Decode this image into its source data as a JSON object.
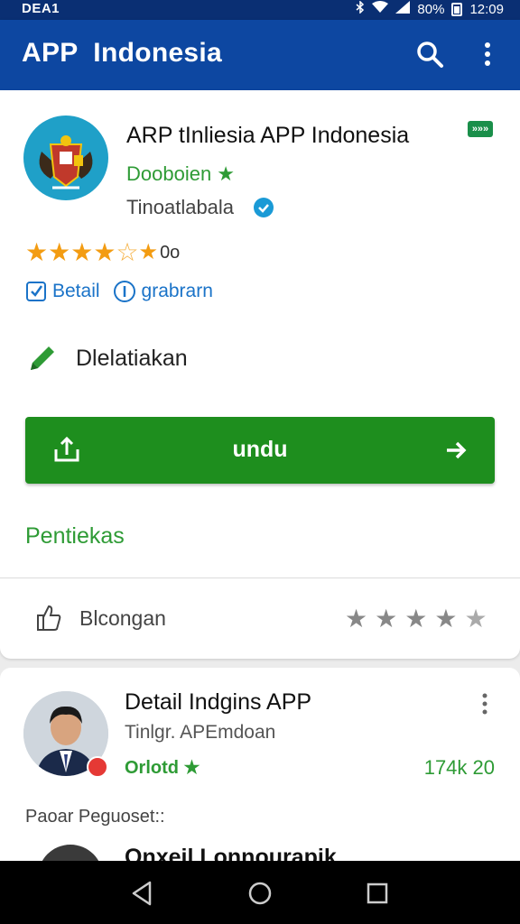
{
  "status_bar": {
    "carrier": "DEA1",
    "battery": "80%",
    "time": "12:09"
  },
  "app_bar": {
    "title": "APP  Indonesia"
  },
  "app_card": {
    "name": "ARP tInliesia APP Indonesia",
    "badge": "»»»",
    "developer": "Dooboien ★",
    "category": "Tinoatlabala",
    "rating_count": "0o",
    "rating_stars": 5,
    "links": {
      "detail": "Betail",
      "info": "grabrarn"
    },
    "edit_label": "Dlelatiakan",
    "download_label": "undu",
    "section_title": "Pentiekas",
    "review_label": "Blcongan"
  },
  "list_item": {
    "title": "Detail Indgins APP",
    "subtitle": "Tinlgr. APEmdoan",
    "developer": "Orlotd ★",
    "count": "174k 20",
    "footer": "Paoar Peguoset::",
    "next_title": "Onxeil Lonnourapik"
  },
  "colors": {
    "primary": "#0d47a1",
    "accent_green": "#1e8e1e",
    "star": "#f39c12",
    "link": "#1a73c8"
  },
  "icons": [
    "wifi-icon",
    "signal-icon",
    "battery-icon",
    "search-icon",
    "more-vert-icon",
    "verified-icon",
    "star-icon",
    "checkbox-icon",
    "info-icon",
    "pencil-icon",
    "download-icon",
    "arrow-right-icon",
    "thumbs-up-icon",
    "back-icon",
    "home-icon",
    "recents-icon"
  ]
}
